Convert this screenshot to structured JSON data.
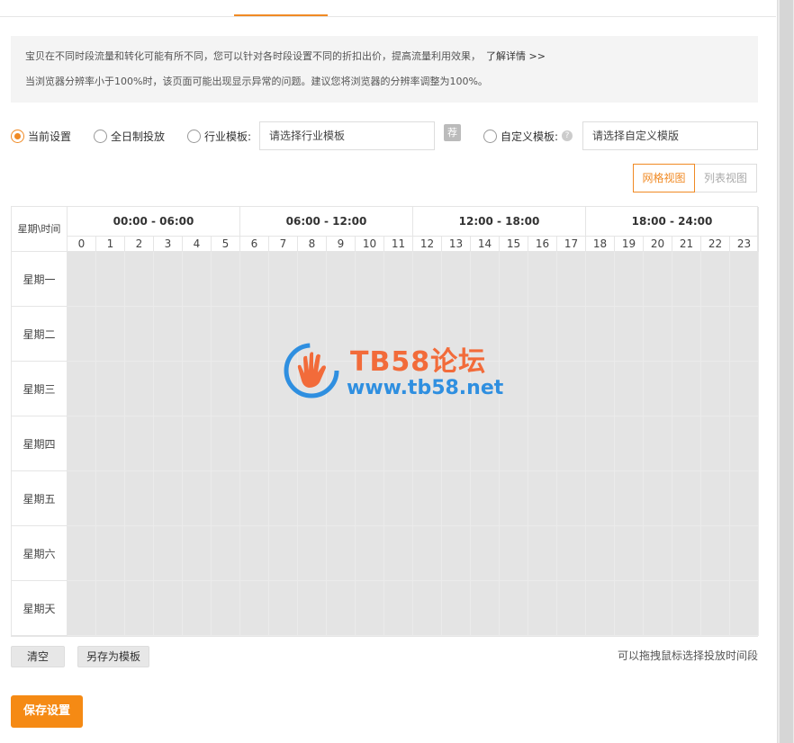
{
  "notice": {
    "line1": "宝贝在不同时段流量和转化可能有所不同，您可以针对各时段设置不同的折扣出价，提高流量利用效果，",
    "link": "了解详情",
    "arrows": ">>",
    "line2": "当浏览器分辨率小于100%时，该页面可能出现显示异常的问题。建议您将浏览器的分辨率调整为100%。"
  },
  "modes": {
    "current": "当前设置",
    "full_day": "全日制投放",
    "industry": "行业模板:",
    "industry_placeholder": "请选择行业模板",
    "recommend_badge": "荐",
    "custom": "自定义模板:",
    "help_glyph": "?",
    "custom_placeholder": "请选择自定义模版",
    "selected": "current"
  },
  "view_toggle": {
    "grid": "网格视图",
    "list": "列表视图",
    "active": "grid"
  },
  "schedule": {
    "corner": "星期\\时间",
    "ranges": [
      "00:00 - 06:00",
      "06:00 - 12:00",
      "12:00 - 18:00",
      "18:00 - 24:00"
    ],
    "hours": [
      "0",
      "1",
      "2",
      "3",
      "4",
      "5",
      "6",
      "7",
      "8",
      "9",
      "10",
      "11",
      "12",
      "13",
      "14",
      "15",
      "16",
      "17",
      "18",
      "19",
      "20",
      "21",
      "22",
      "23"
    ],
    "days": [
      "星期一",
      "星期二",
      "星期三",
      "星期四",
      "星期五",
      "星期六",
      "星期天"
    ]
  },
  "watermark": {
    "title": "TB58论坛",
    "url": "www.tb58.net"
  },
  "actions": {
    "clear": "清空",
    "save_template": "另存为模板",
    "hint": "可以拖拽鼠标选择投放时间段",
    "save": "保存设置"
  },
  "colors": {
    "accent": "#f08a24",
    "cell": "#e4e4e4",
    "save_button": "#f58a14"
  }
}
